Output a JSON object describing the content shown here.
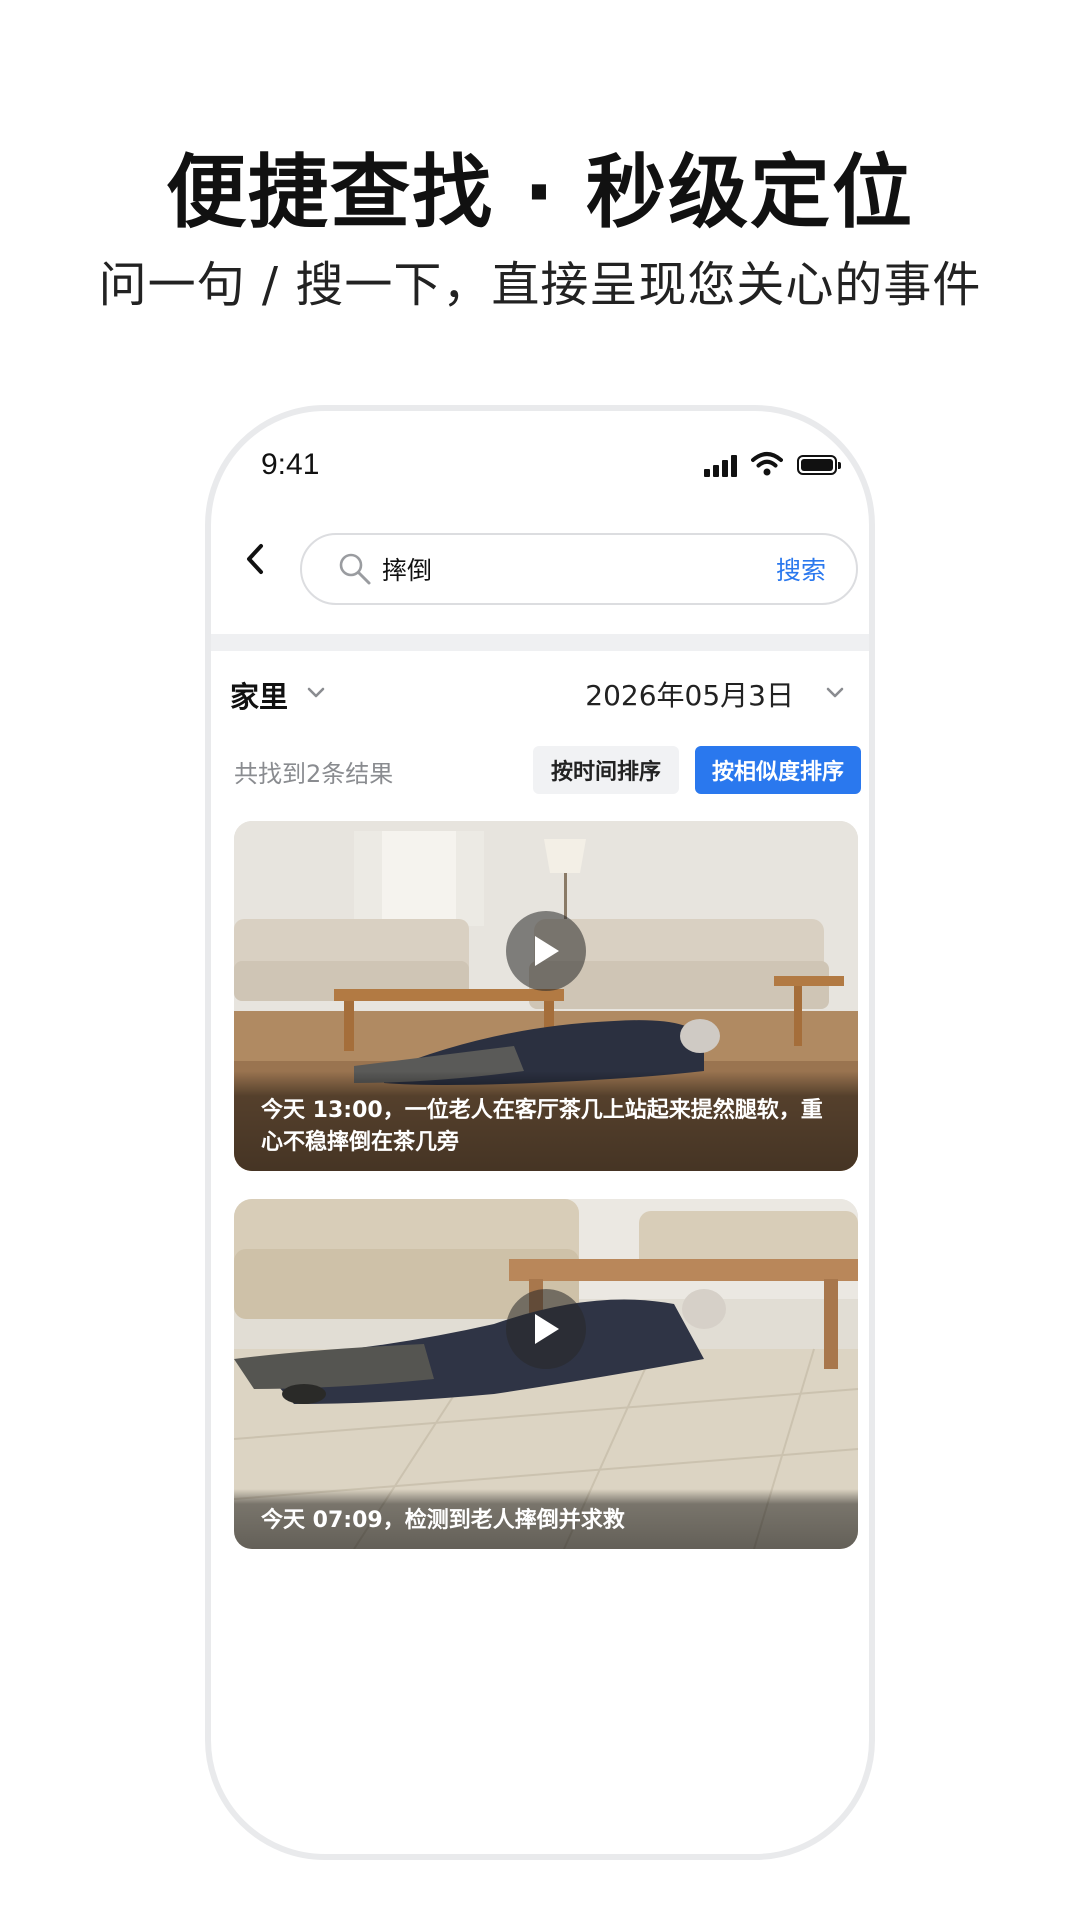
{
  "headline": "便捷查找 · 秒级定位",
  "subheadline": "问一句 / 搜一下，直接呈现您关心的事件",
  "phone": {
    "status_bar": {
      "time": "9:41"
    },
    "search": {
      "query": "摔倒",
      "button_label": "搜索"
    },
    "filters": {
      "location": "家里",
      "date": "2026年05月3日"
    },
    "results": {
      "count_text": "共找到2条结果",
      "sort_by_time_label": "按时间排序",
      "sort_by_similarity_label": "按相似度排序",
      "active_sort": "similarity",
      "items": [
        {
          "caption": "今天 13:00，一位老人在客厅茶几上站起来提然腿软，重心不稳摔倒在茶几旁"
        },
        {
          "caption": "今天 07:09，检测到老人摔倒并求救"
        }
      ]
    }
  },
  "colors": {
    "accent": "#2a78ee",
    "phone_border": "#e9eaec",
    "divider": "#eff0f2",
    "muted_text": "#8a8c90"
  },
  "icons": [
    "back-chevron-icon",
    "search-icon",
    "chevron-down-icon",
    "play-icon",
    "signal-icon",
    "wifi-icon",
    "battery-icon"
  ]
}
